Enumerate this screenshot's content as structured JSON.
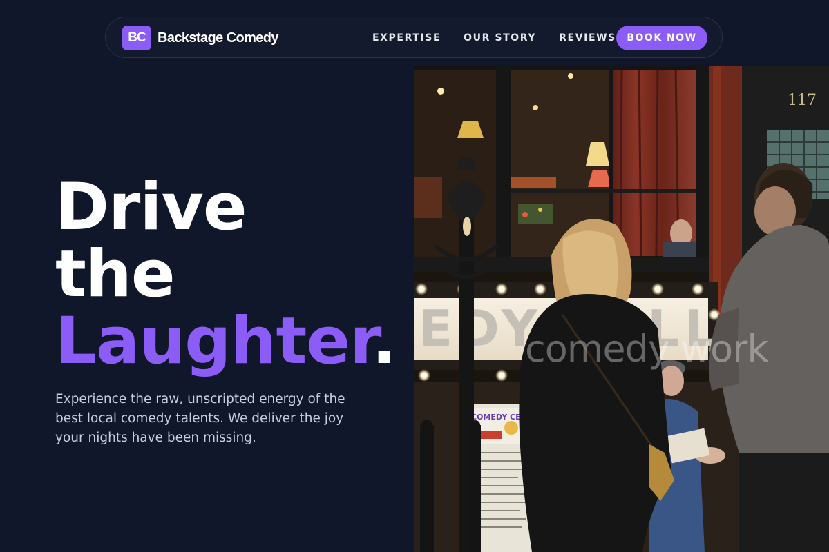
{
  "brand": {
    "logo_text": "BC",
    "name": "Backstage Comedy"
  },
  "nav": {
    "links": [
      "EXPERTISE",
      "OUR STORY",
      "REVIEWS"
    ],
    "cta": "BOOK NOW"
  },
  "hero": {
    "line1": "Drive",
    "line2": "the",
    "line3": "Laughter",
    "line3_suffix": ".",
    "subtitle": "Experience the raw, unscripted energy of the best local comedy talents. We deliver the joy your nights have been missing."
  },
  "photo": {
    "door_number": "117",
    "marquee_text": "EDY CELLAR",
    "poster_text": "COMEDY CELLAR",
    "watermark": "comedy work"
  },
  "colors": {
    "background": "#11172a",
    "accent": "#8b5cf6",
    "text": "#ffffff",
    "muted": "#c9cede"
  }
}
